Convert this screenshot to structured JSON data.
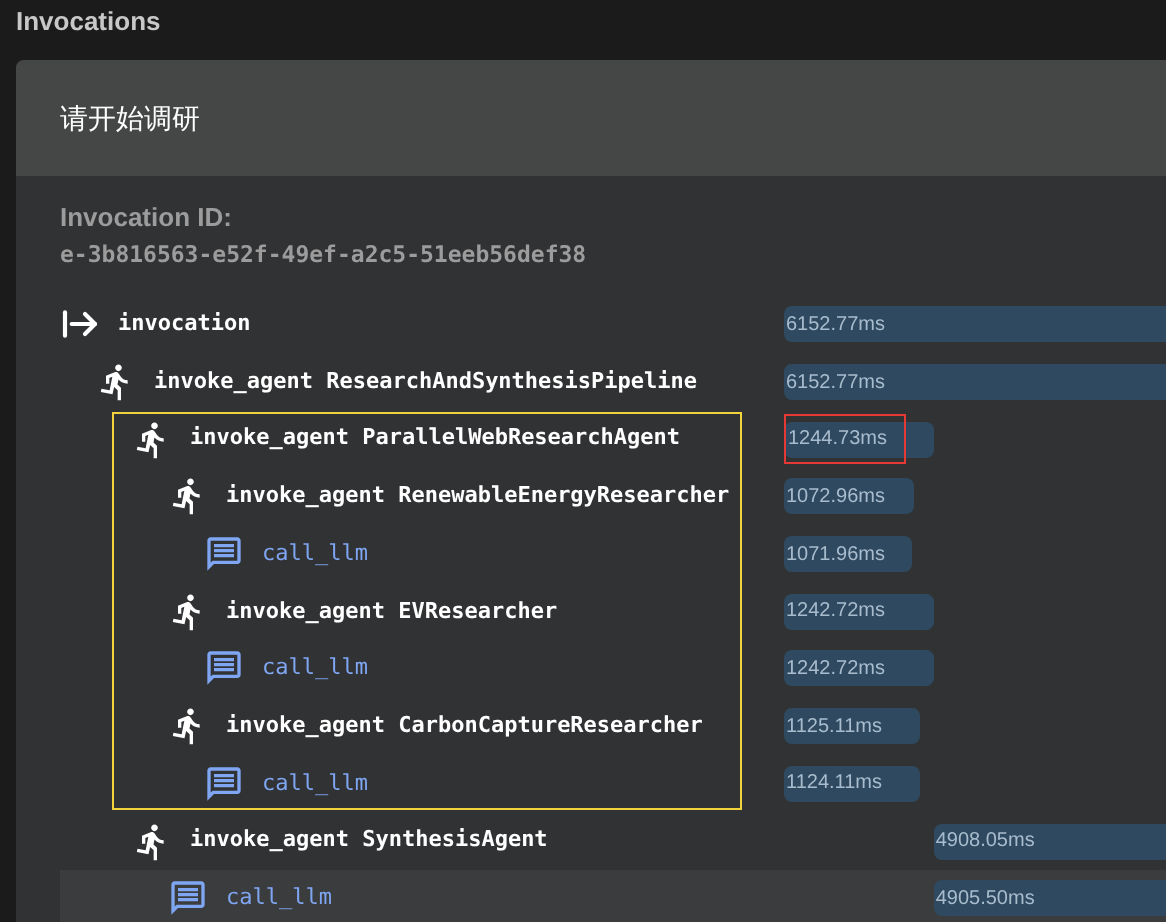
{
  "page_title": "Invocations",
  "card": {
    "title": "请开始调研",
    "id_label": "Invocation ID:",
    "id_value": "e-3b816563-e52f-49ef-a2c5-51eeb56def38"
  },
  "tree": [
    {
      "kind": "invocation",
      "name": "invocation",
      "duration": "6152.77ms",
      "children": [
        {
          "kind": "agent",
          "name": "invoke_agent ResearchAndSynthesisPipeline",
          "duration": "6152.77ms",
          "children": [
            {
              "kind": "agent",
              "name": "invoke_agent ParallelWebResearchAgent",
              "duration": "1244.73ms",
              "highlighted": true,
              "duration_highlighted": true,
              "children": [
                {
                  "kind": "agent",
                  "name": "invoke_agent RenewableEnergyResearcher",
                  "duration": "1072.96ms",
                  "children": [
                    {
                      "kind": "llm",
                      "name": "call_llm",
                      "duration": "1071.96ms"
                    }
                  ]
                },
                {
                  "kind": "agent",
                  "name": "invoke_agent EVResearcher",
                  "duration": "1242.72ms",
                  "children": [
                    {
                      "kind": "llm",
                      "name": "call_llm",
                      "duration": "1242.72ms"
                    }
                  ]
                },
                {
                  "kind": "agent",
                  "name": "invoke_agent CarbonCaptureResearcher",
                  "duration": "1125.11ms",
                  "children": [
                    {
                      "kind": "llm",
                      "name": "call_llm",
                      "duration": "1124.11ms"
                    }
                  ]
                }
              ]
            },
            {
              "kind": "agent",
              "name": "invoke_agent SynthesisAgent",
              "duration": "4908.05ms",
              "children": [
                {
                  "kind": "llm",
                  "name": "call_llm",
                  "duration": "4905.50ms",
                  "hovered": true
                }
              ]
            }
          ]
        }
      ]
    }
  ]
}
